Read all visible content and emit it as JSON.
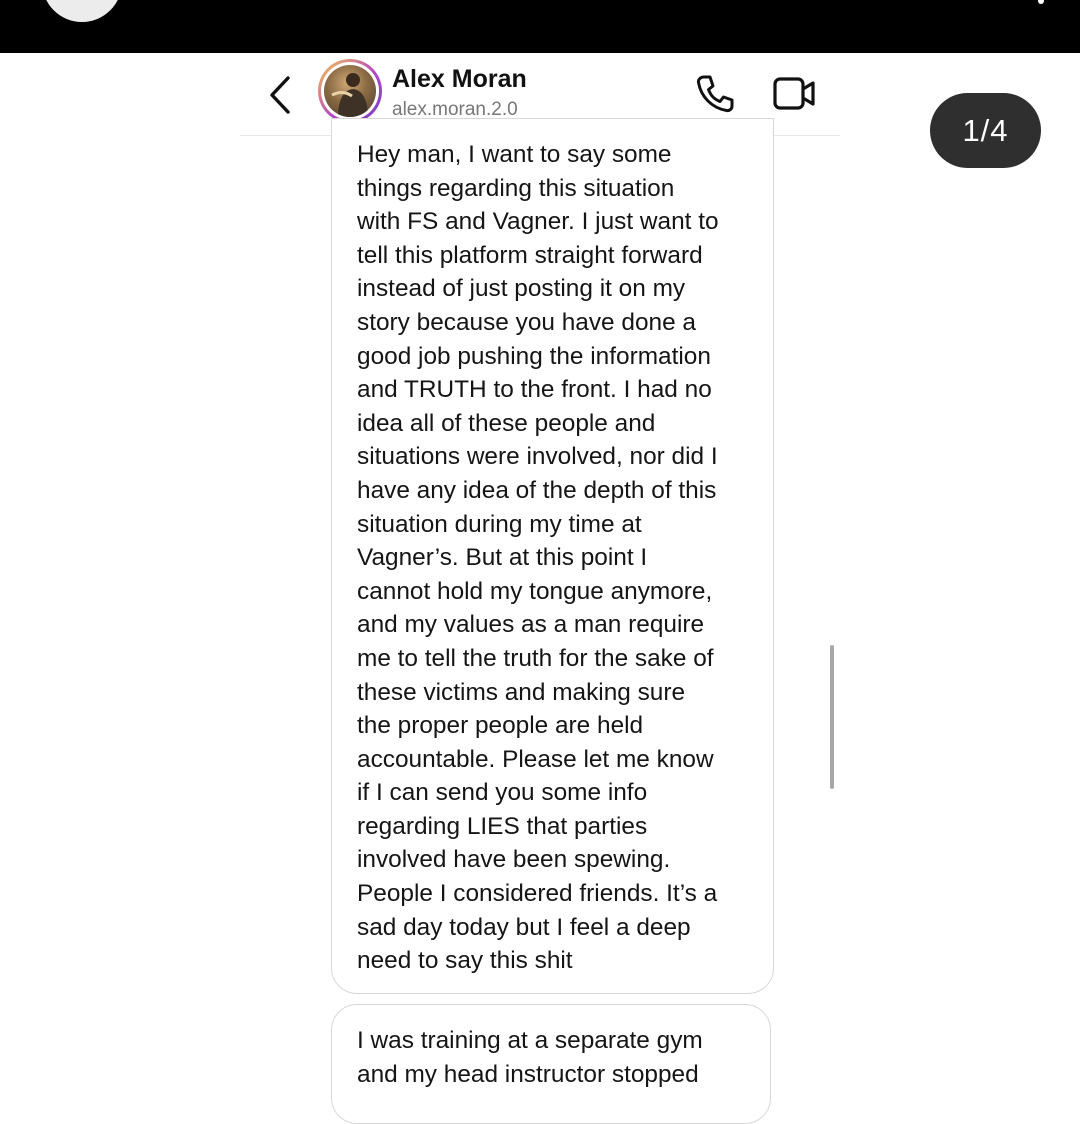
{
  "colors": {
    "topbar": "#000000",
    "badge": "#2f2f2f",
    "bubble_border": "#d8d8d8",
    "avatar_ring": [
      "#f7c948",
      "#b548c6",
      "#6f3fbf"
    ]
  },
  "header": {
    "contact_name": "Alex Moran",
    "contact_handle": "alex.moran.2.0",
    "icons": [
      "chevron-left-icon",
      "phone-icon",
      "video-camera-icon"
    ]
  },
  "page_indicator": "1/4",
  "messages": [
    {
      "text": "Hey man, I want to say some\nthings regarding this situation\nwith FS and Vagner. I just want to\ntell this platform straight forward\ninstead of just posting it on my\nstory because you have done a\ngood job pushing the information\nand TRUTH to the front. I had no\nidea all of these people and\nsituations were involved, nor did I\nhave any idea of the depth of this\nsituation during my time at\nVagner’s. But at this point I\ncannot hold my tongue anymore,\nand my values as a man require\nme to tell the truth for the sake of\nthese victims and making sure\nthe proper people are held\naccountable. Please let me know\nif I can send you some info\nregarding LIES that parties\ninvolved have been spewing.\nPeople I considered friends. It’s a\nsad day today but I feel a deep\nneed to say this shit"
    },
    {
      "text": "I was training at a separate gym\nand my head instructor stopped"
    }
  ]
}
